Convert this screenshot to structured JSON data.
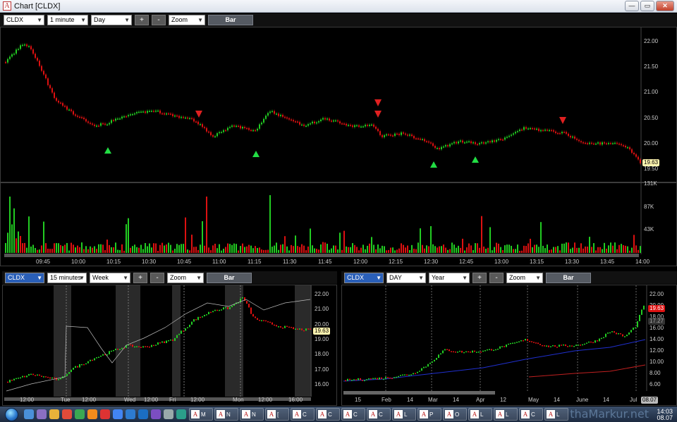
{
  "window": {
    "title": "Chart [CLDX]",
    "app_icon_letter": "A",
    "buttons": [
      "—",
      "▭",
      "✕"
    ]
  },
  "main_chart": {
    "toolbar": {
      "symbol": "CLDX",
      "interval": "1 minute",
      "range": "Day",
      "plus": "+",
      "minus": "-",
      "zoom": "Zoom",
      "style": "Bar"
    },
    "y_ticks": [
      "22.00",
      "21.50",
      "21.00",
      "20.50",
      "20.00",
      "19.50"
    ],
    "last_price": "19.63",
    "volume_ticks": [
      "131K",
      "87K",
      "43K"
    ],
    "x_ticks": [
      "09:45",
      "10:00",
      "10:15",
      "10:30",
      "10:45",
      "11:00",
      "11:15",
      "11:30",
      "11:45",
      "12:00",
      "12:15",
      "12:30",
      "12:45",
      "13:00",
      "13:15",
      "13:30",
      "13:45",
      "14:00"
    ]
  },
  "bottom_left_chart": {
    "toolbar": {
      "symbol": "CLDX",
      "interval": "15 minutes",
      "range": "Week",
      "plus": "+",
      "minus": "-",
      "zoom": "Zoom",
      "style": "Bar"
    },
    "y_ticks": [
      "22.00",
      "21.00",
      "20.00",
      "19.00",
      "18.00",
      "17.00",
      "16.00"
    ],
    "last_price": "19.63",
    "x_ticks": [
      "12:00",
      "Tue",
      "12:00",
      "Wed",
      "12:00",
      "Fri",
      "12:00",
      "Mon",
      "12:00",
      "16:00"
    ]
  },
  "bottom_right_chart": {
    "toolbar": {
      "symbol": "CLDX",
      "interval": "DAY",
      "range": "Year",
      "plus": "+",
      "minus": "-",
      "zoom": "Zoom",
      "style": "Bar"
    },
    "y_ticks": [
      "22.00",
      "20.00",
      "18.00",
      "16.00",
      "14.00",
      "12.00",
      "10.00",
      "8.00",
      "6.00"
    ],
    "last_price": "19.63",
    "ma_value": "17.27",
    "x_ticks": [
      "15",
      "Feb",
      "14",
      "Mar",
      "14",
      "Apr",
      "12",
      "May",
      "14",
      "June",
      "14",
      "Jul"
    ],
    "date_badge": "08.07"
  },
  "taskbar": {
    "task_labels": [
      "M",
      "N",
      "N",
      "[",
      "C",
      "C",
      "C",
      "C",
      "L",
      "P",
      "O",
      "L",
      "L",
      "C",
      "L"
    ],
    "clock_time": "14:03",
    "clock_date": "08.07"
  },
  "watermark": "thaMarkur.net",
  "colors": {
    "up": "#22cc22",
    "down": "#dd1111",
    "background": "#000000",
    "grid": "#333333"
  }
}
